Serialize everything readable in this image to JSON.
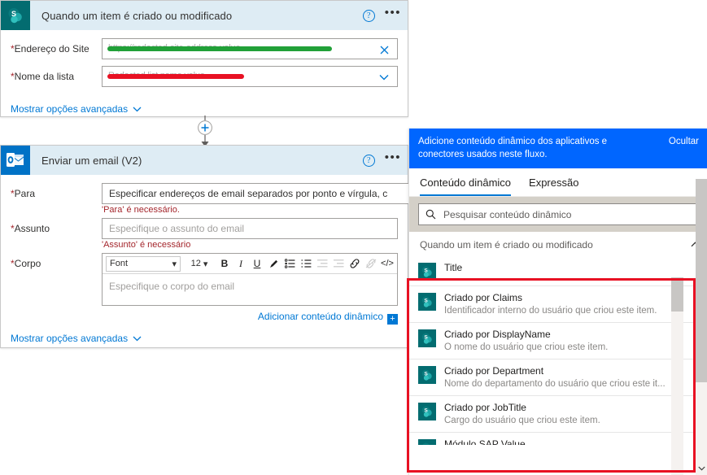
{
  "trigger_card": {
    "title": "Quando um item é criado ou modificado",
    "app_icon": "sharepoint-icon",
    "help_icon": "help-icon",
    "more_icon": "more-options-icon",
    "fields": [
      {
        "label": "Endereço do Site",
        "required": true,
        "value_redacted": "https://redacted-site-address-value",
        "redaction_color": "#21a038",
        "right_icon": "clear-icon"
      },
      {
        "label": "Nome da lista",
        "required": true,
        "value_redacted": "Redacted list name value",
        "redaction_color": "#e81123",
        "right_icon": "chevron-down-icon"
      }
    ],
    "advanced_link": "Mostrar opções avançadas"
  },
  "connector": {
    "add_icon": "add-step-plus-icon",
    "arrow_icon": "arrow-down-icon"
  },
  "email_card": {
    "title": "Enviar um email (V2)",
    "app_icon": "outlook-icon",
    "help_icon": "help-icon",
    "more_icon": "more-options-icon",
    "to_field": {
      "label": "Para",
      "required": true,
      "placeholder": "Especificar endereços de email separados por ponto e vírgula, c",
      "error": "'Para' é necessário."
    },
    "subject_field": {
      "label": "Assunto",
      "required": true,
      "placeholder": "Especifique o assunto do email",
      "error": "'Assunto' é necessário"
    },
    "body_field": {
      "label": "Corpo",
      "required": true,
      "placeholder": "Especifique o corpo do email",
      "toolbar": {
        "font_name": "Font",
        "font_size": "12",
        "bold": "B",
        "italic": "I",
        "underline": "U",
        "highlight_icon": "highlight-pen-icon",
        "bullet_list_icon": "bulleted-list-icon",
        "numbered_list_icon": "numbered-list-icon",
        "outdent_icon": "decrease-indent-icon",
        "indent_icon": "increase-indent-icon",
        "link_icon": "insert-link-icon",
        "unlink_icon": "remove-link-icon",
        "code_icon": "code-view-icon"
      }
    },
    "dynamic_link": "Adicionar conteúdo dinâmico",
    "dynamic_plus": "+",
    "advanced_link": "Mostrar opções avançadas"
  },
  "dynamic_panel": {
    "header_text": "Adicione conteúdo dinâmico dos aplicativos e conectores usados neste fluxo.",
    "header_line1": "Adicione conteúdo dinâmico dos aplicativos e",
    "header_line2": "conectores usados neste fluxo.",
    "hide_label": "Ocultar",
    "header_color": "#0066ff",
    "tabs": [
      {
        "label": "Conteúdo dinâmico",
        "active": true
      },
      {
        "label": "Expressão",
        "active": false
      }
    ],
    "search": {
      "placeholder": "Pesquisar conteúdo dinâmico",
      "icon": "search-icon",
      "value": ""
    },
    "group_title": "Quando um item é criado ou modificado",
    "collapse_icon": "chevron-up-icon",
    "items": [
      {
        "name": "Title",
        "desc": "",
        "icon": "sharepoint-icon"
      },
      {
        "name": "Criado por Claims",
        "desc": "Identificador interno do usuário que criou este item.",
        "icon": "sharepoint-icon"
      },
      {
        "name": "Criado por DisplayName",
        "desc": "O nome do usuário que criou este item.",
        "icon": "sharepoint-icon"
      },
      {
        "name": "Criado por Department",
        "desc": "Nome do departamento do usuário que criou este it...",
        "icon": "sharepoint-icon"
      },
      {
        "name": "Criado por JobTitle",
        "desc": "Cargo do usuário que criou este item.",
        "icon": "sharepoint-icon"
      },
      {
        "name": "Módulo SAP Value",
        "desc": "",
        "icon": "sharepoint-icon"
      }
    ],
    "scroll_up_icon": "scroll-up-icon",
    "scroll_down_icon": "scroll-down-icon"
  },
  "annotation": {
    "color": "#e81123",
    "shape": "rectangle-highlight"
  }
}
